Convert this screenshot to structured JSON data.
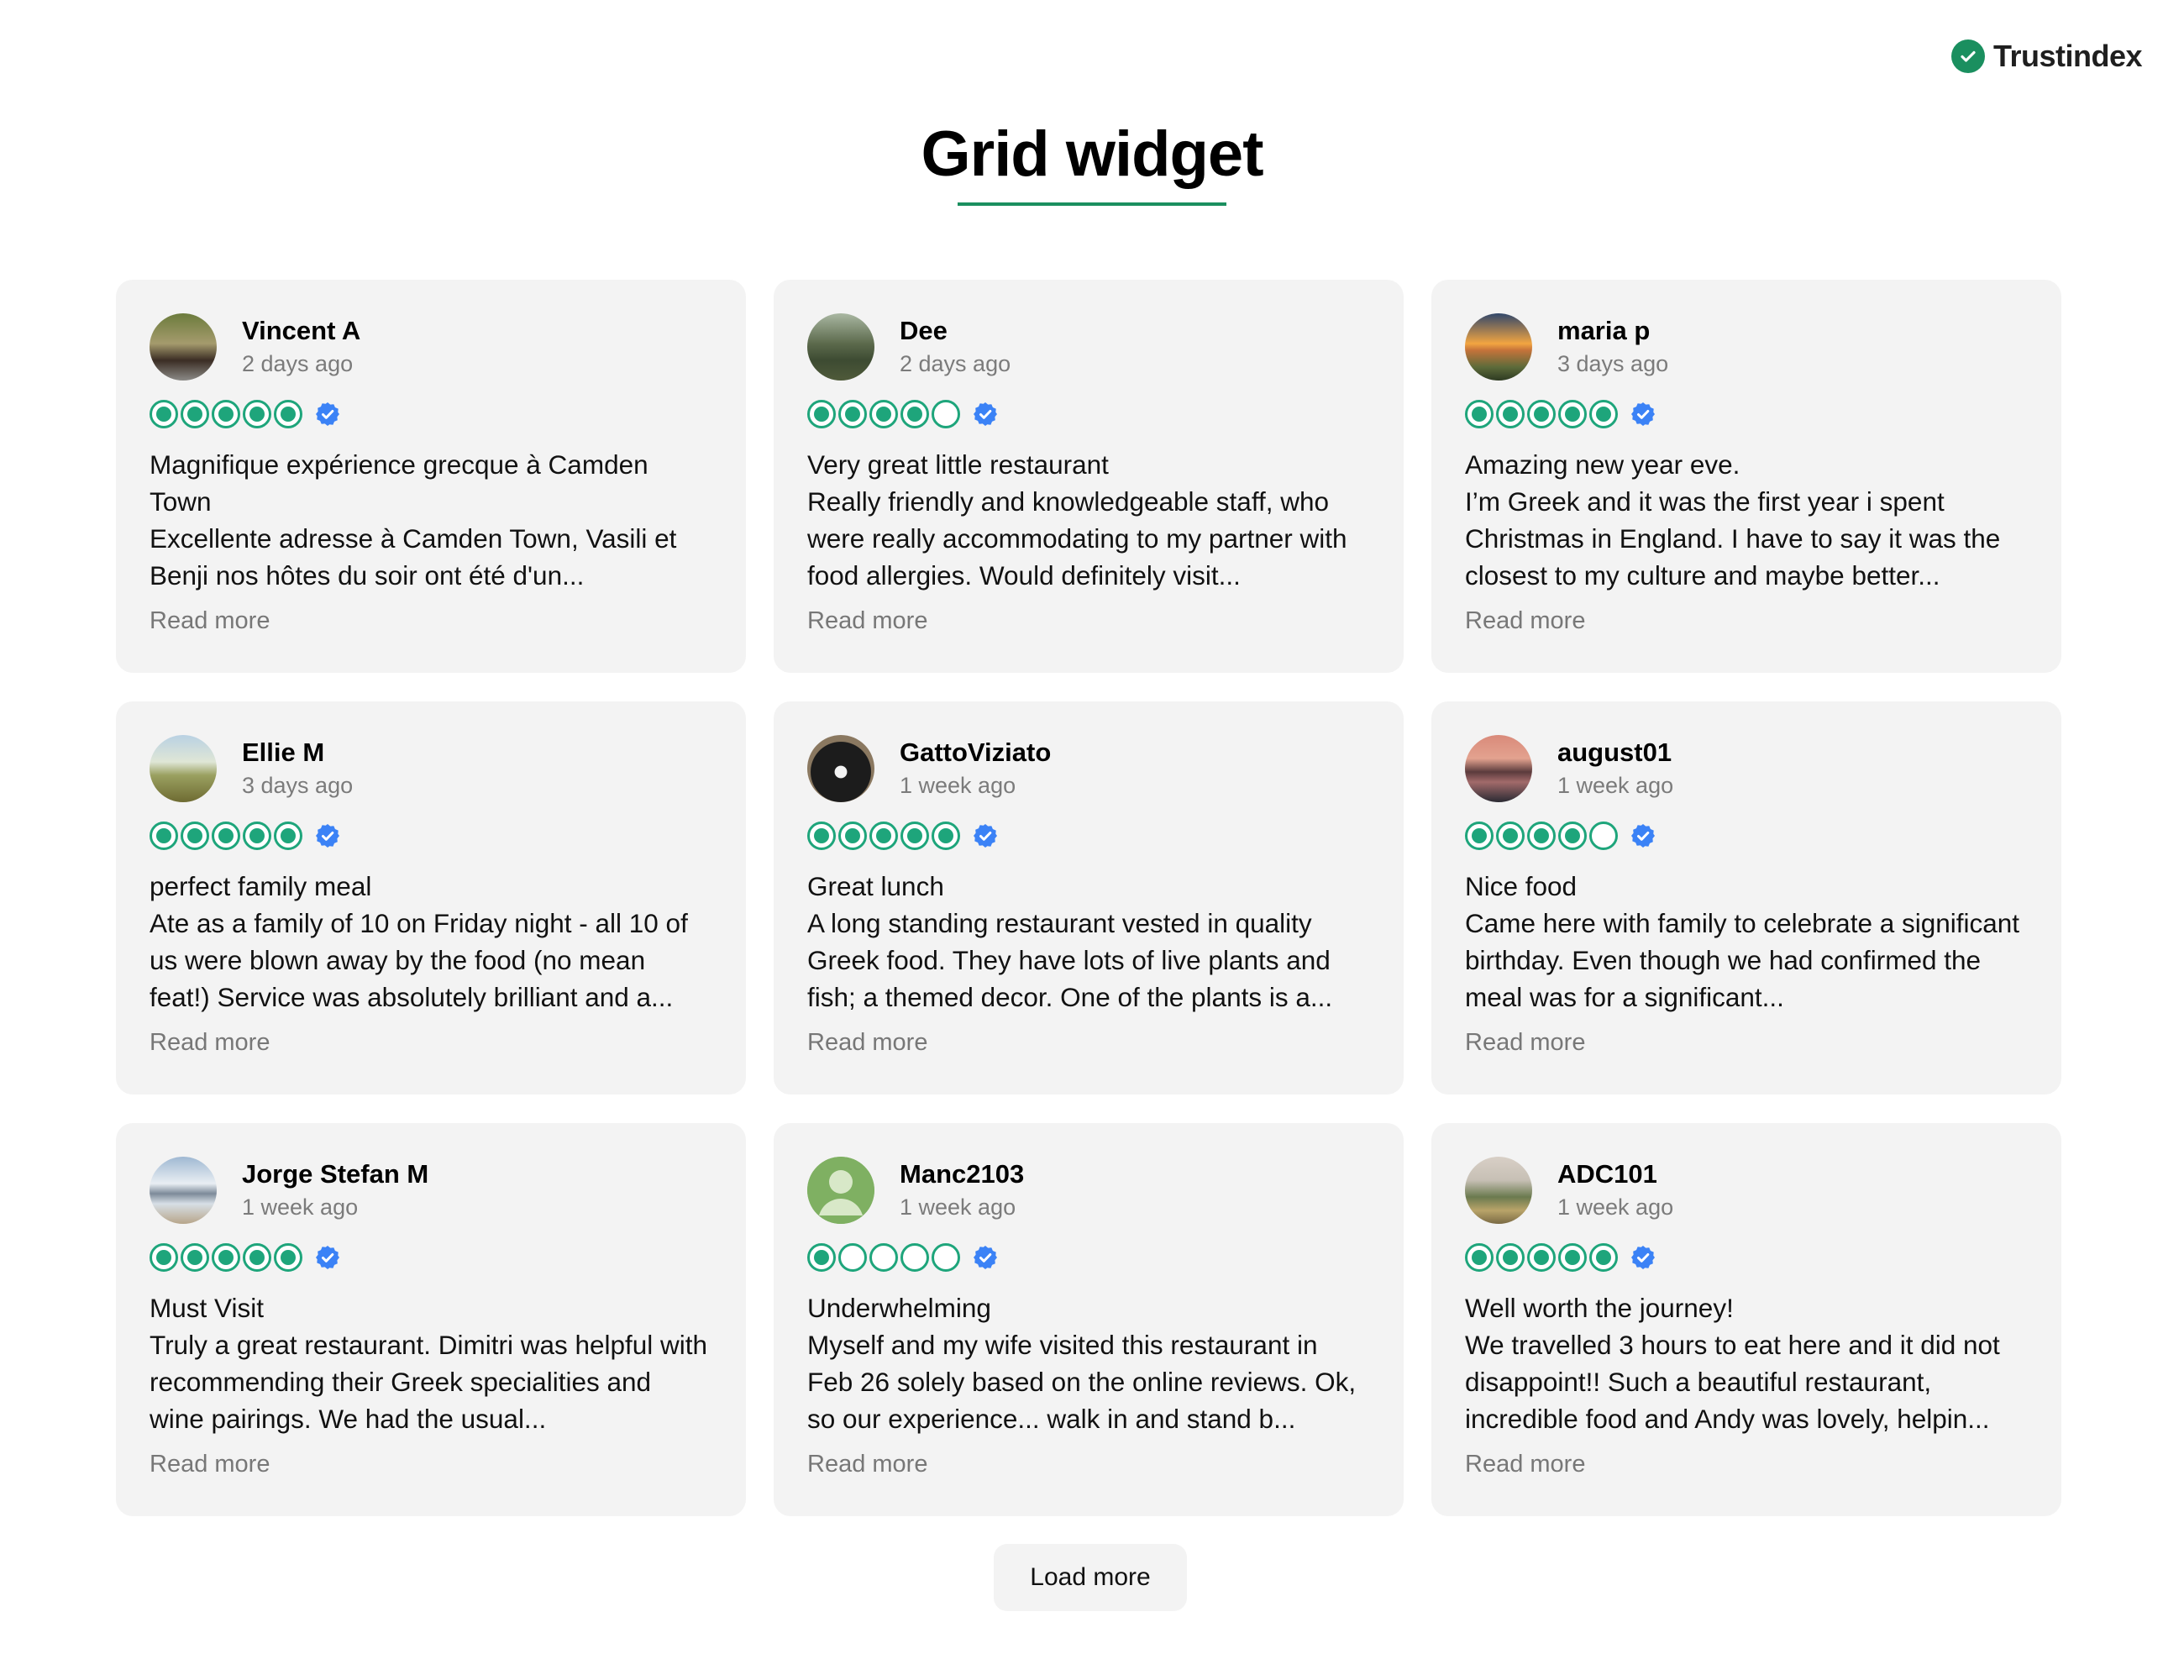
{
  "brand": {
    "name": "Trustindex",
    "color": "#1a8f5f"
  },
  "page": {
    "title": "Grid widget"
  },
  "load_more_label": "Load more",
  "read_more_label": "Read more",
  "colors": {
    "star": "#1ea57b",
    "verified": "#3b82f6",
    "card_bg": "#f3f3f3"
  },
  "reviews": [
    {
      "name": "Vincent A",
      "date": "2 days ago",
      "rating": 5,
      "verified": true,
      "avatar": "avatar-cyclists-photo",
      "title": "Magnifique expérience grecque à Camden Town",
      "body": "Excellente adresse à Camden Town, Vasili et Benji nos hôtes du soir ont été d'un..."
    },
    {
      "name": "Dee",
      "date": "2 days ago",
      "rating": 4,
      "verified": true,
      "avatar": "avatar-tent-photo",
      "title": "Very great little restaurant",
      "body": "Really friendly and knowledgeable staff, who were really accommodating to my partner with food allergies. Would definitely visit..."
    },
    {
      "name": "maria p",
      "date": "3 days ago",
      "rating": 5,
      "verified": true,
      "avatar": "avatar-sunset-photo",
      "title": "Amazing new year eve.",
      "body": "I’m Greek and it was the first year i spent Christmas in England. I have to say it was the closest to my culture and maybe better..."
    },
    {
      "name": "Ellie M",
      "date": "3 days ago",
      "rating": 5,
      "verified": true,
      "avatar": "avatar-hills-photo",
      "title": "perfect family meal",
      "body": "Ate as a family of 10 on Friday night - all 10 of us were blown away by the food (no mean feat!) Service was absolutely brilliant and a..."
    },
    {
      "name": "GattoViziato",
      "date": "1 week ago",
      "rating": 5,
      "verified": true,
      "avatar": "avatar-cat-photo",
      "title": "Great lunch",
      "body": "A long standing restaurant vested in quality Greek food. They have lots of live plants and fish; a themed decor. One of the plants is a..."
    },
    {
      "name": "august01",
      "date": "1 week ago",
      "rating": 4,
      "verified": true,
      "avatar": "avatar-pier-photo",
      "title": "Nice food",
      "body": "Came here with family to celebrate a significant birthday. Even though we had confirmed the meal was for a significant..."
    },
    {
      "name": "Jorge Stefan M",
      "date": "1 week ago",
      "rating": 5,
      "verified": true,
      "avatar": "avatar-mountain-photo",
      "title": "Must Visit",
      "body": "Truly a great restaurant. Dimitri was helpful with recommending their Greek specialities and wine pairings. We had the usual..."
    },
    {
      "name": "Manc2103",
      "date": "1 week ago",
      "rating": 1,
      "verified": true,
      "avatar": "avatar-default-person",
      "title": "Underwhelming",
      "body": "Myself and my wife visited this restaurant in Feb 26 solely based on the online reviews. Ok, so our experience... walk in and stand b..."
    },
    {
      "name": "ADC101",
      "date": "1 week ago",
      "rating": 5,
      "verified": true,
      "avatar": "avatar-landscape-photo",
      "title": "Well worth the journey!",
      "body": "We travelled 3 hours to eat here and it did not disappoint!! Such a beautiful restaurant, incredible food and Andy was lovely, helpin..."
    }
  ]
}
